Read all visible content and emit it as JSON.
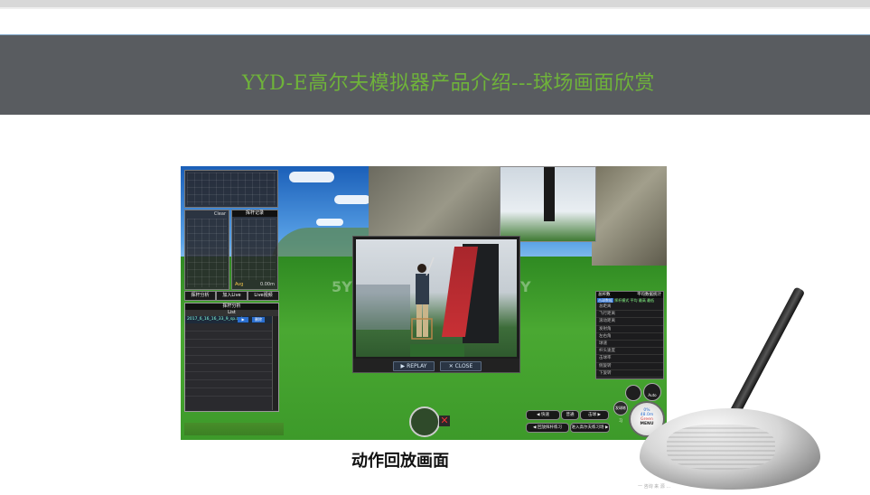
{
  "banner": {
    "title": "YYD-E高尔夫模拟器产品介绍---球场画面欣赏"
  },
  "screenshot": {
    "left_panel": {
      "clear_label": "Clear",
      "trajectory_label": "挥杆记录",
      "avg_label": "Avg",
      "distance_value": "0.00m",
      "buttons": [
        "挥杆分析",
        "加入Live",
        "Live视频"
      ],
      "analysis_title": "挥杆分析",
      "list_title": "List",
      "list_item": "2017_6_16_16_33_9_sp.avi",
      "list_buttons": [
        "▶",
        "删除"
      ]
    },
    "replay_modal": {
      "watermark": "5Y",
      "watermark_right": "Y",
      "replay_button": "REPLAY",
      "close_button": "CLOSE"
    },
    "right_panel": {
      "header_left": "总杆数",
      "header_right": "平均数据统计",
      "tabs": [
        "击球数据",
        "挥杆模式",
        "平均",
        "最高",
        "最低"
      ],
      "rows": [
        "总距离",
        "飞行距离",
        "滚动距离",
        "发射角",
        "左右角",
        "球速",
        "杆头速度",
        "击球率",
        "侧旋转",
        "下旋转"
      ]
    },
    "bottom_controls": {
      "speed_label": "快速",
      "normal_label": "普通",
      "hit_ball_label": "击球",
      "record_label": "发球练习",
      "practice_label": "进入高尔夫练习场",
      "replay_label": "发球击球",
      "swing_btn": "回放挥杆练习",
      "auto_label": "Auto",
      "green_label": "Green",
      "percent": "0%",
      "distance": "48.0m",
      "menu_label": "MENU"
    }
  },
  "caption": "动作回放画面",
  "watermark": "一 咨询 来 源 ..."
}
